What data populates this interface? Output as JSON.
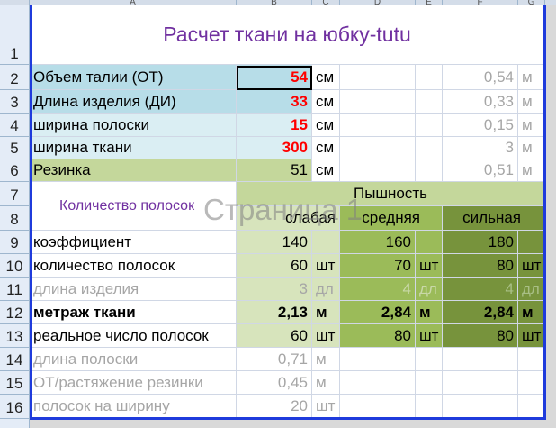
{
  "columns": [
    "А",
    "B",
    "C",
    "D",
    "E",
    "F",
    "G"
  ],
  "rows": [
    "1",
    "2",
    "3",
    "4",
    "5",
    "6",
    "7",
    "8",
    "9",
    "10",
    "11",
    "12",
    "13",
    "14",
    "15",
    "16"
  ],
  "title": "Расчет ткани на юбку-tutu",
  "watermark": "Страница 1",
  "params": [
    {
      "label": "Объем талии (ОТ)",
      "value": "54",
      "unit": "см",
      "m_value": "0,54",
      "m_unit": "м"
    },
    {
      "label": "Длина изделия (ДИ)",
      "value": "33",
      "unit": "см",
      "m_value": "0,33",
      "m_unit": "м"
    },
    {
      "label": "ширина полоски",
      "value": "15",
      "unit": "см",
      "m_value": "0,15",
      "m_unit": "м"
    },
    {
      "label": "ширина ткани",
      "value": "300",
      "unit": "см",
      "m_value": "3",
      "m_unit": "м"
    },
    {
      "label": "Резинка",
      "value": "51",
      "unit": "см",
      "m_value": "0,51",
      "m_unit": "м"
    }
  ],
  "strip_count_label": "Количество полосок",
  "pyshnost": "Пышность",
  "levels": [
    "слабая",
    "средняя",
    "сильная"
  ],
  "table": [
    {
      "label": "коэффициент",
      "vals": [
        "140",
        "160",
        "180"
      ],
      "unit": ""
    },
    {
      "label": "количество полосок",
      "vals": [
        "60",
        "70",
        "80"
      ],
      "unit": "шт"
    },
    {
      "label": "длина изделия",
      "vals": [
        "3",
        "4",
        "4"
      ],
      "unit": "дл"
    },
    {
      "label": "метраж ткани",
      "vals": [
        "2,13",
        "2,84",
        "2,84"
      ],
      "unit": "м"
    },
    {
      "label": "реальное число полосок",
      "vals": [
        "60",
        "80",
        "80"
      ],
      "unit": "шт"
    }
  ],
  "extra": [
    {
      "label": "длина полоски",
      "value": "0,71",
      "unit": "м"
    },
    {
      "label": "ОТ/растяжение резинки",
      "value": "0,45",
      "unit": "м"
    },
    {
      "label": "полосок на ширину",
      "value": "20",
      "unit": "шт"
    }
  ]
}
